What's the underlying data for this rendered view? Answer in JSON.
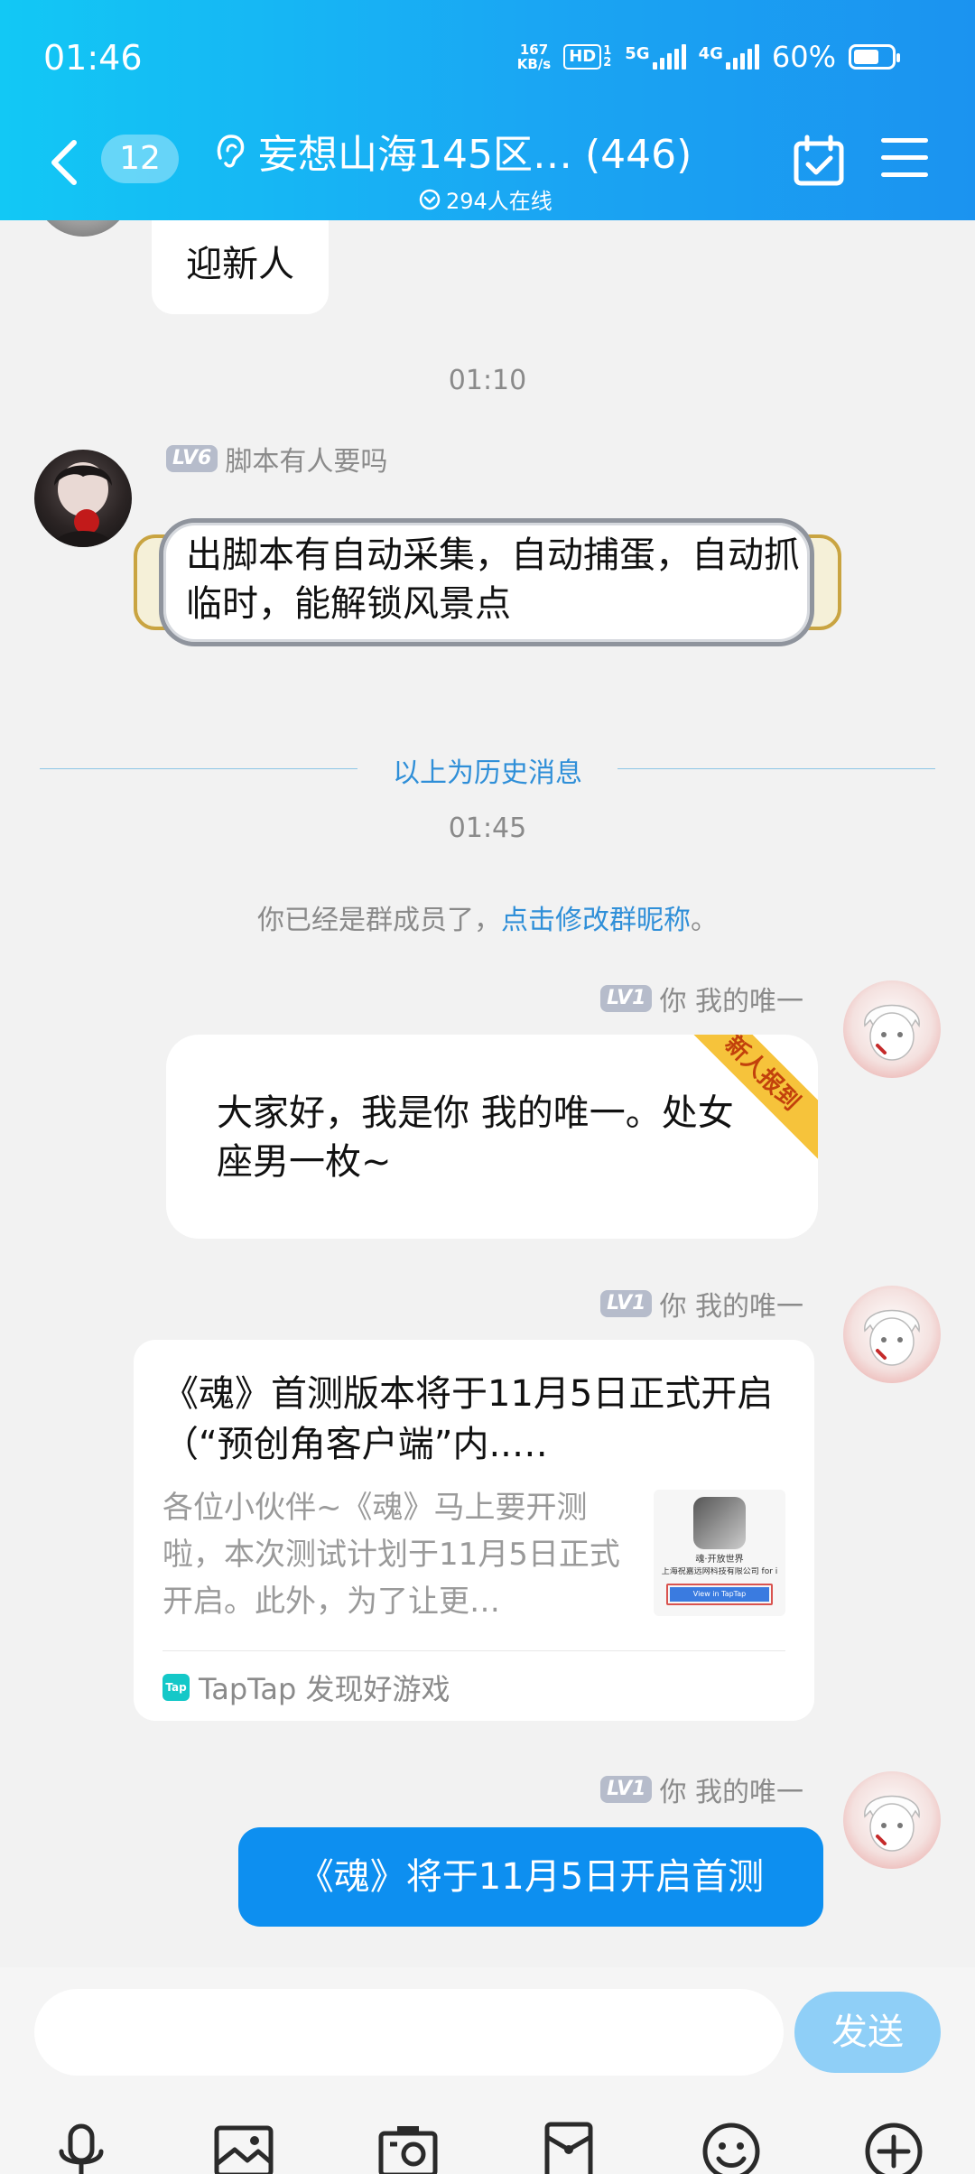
{
  "status_bar": {
    "time": "01:46",
    "net_speed_value": "167",
    "net_speed_unit": "KB/s",
    "hd": "HD",
    "hd_sub": "1 2",
    "net5g": "5G",
    "net4g": "4G",
    "battery": "60%",
    "battery_level": 0.6
  },
  "header": {
    "unread_count": "12",
    "title": "妄想山海145区… (446)",
    "online": "294人在线"
  },
  "messages": {
    "m0_text": "迎新人",
    "t1": "01:10",
    "m1_level": "LV6",
    "m1_name": "脚本有人要吗",
    "m1_text": "出脚本有自动采集，自动捕蛋，自动抓临时，能解锁风景点",
    "history_divider": "以上为历史消息",
    "t2": "01:45",
    "system_prefix": "你已经是群成员了，",
    "system_link": "点击修改群昵称",
    "system_suffix": "。",
    "m2_level": "LV1",
    "m2_name": "你  我的唯一",
    "m2_badge": "新人报到",
    "m2_text": "大家好，我是你  我的唯一。处女座男一枚~",
    "m3_level": "LV1",
    "m3_name": "你  我的唯一",
    "m3_card_title": "《魂》首测版本将于11月5日正式开启（“预创角客户端”内..…",
    "m3_card_desc": "各位小伙伴~《魂》马上要开测啦，本次测试计划于11月5日正式开启。此外，为了让更…",
    "m3_thumb_line1": "魂·开放世界",
    "m3_thumb_line2": "上海祝嘉远网科技有限公司 for i",
    "m3_thumb_btn": "View in TapTap",
    "m3_source_icon": "Tap",
    "m3_source": "TapTap 发现好游戏",
    "m4_level": "LV1",
    "m4_name": "你  我的唯一",
    "m4_text": "《魂》将于11月5日开启首测"
  },
  "input": {
    "placeholder": "",
    "send_label": "发送"
  },
  "toolbar": {
    "icons": [
      "microphone-icon",
      "image-icon",
      "camera-icon",
      "red-packet-icon",
      "emoji-icon",
      "plus-icon"
    ]
  },
  "colors": {
    "header_start": "#12c8f5",
    "header_end": "#1b93f0",
    "sent_bubble": "#0d8ff0",
    "link": "#2f8fd8",
    "send_button": "#8fcff7"
  }
}
